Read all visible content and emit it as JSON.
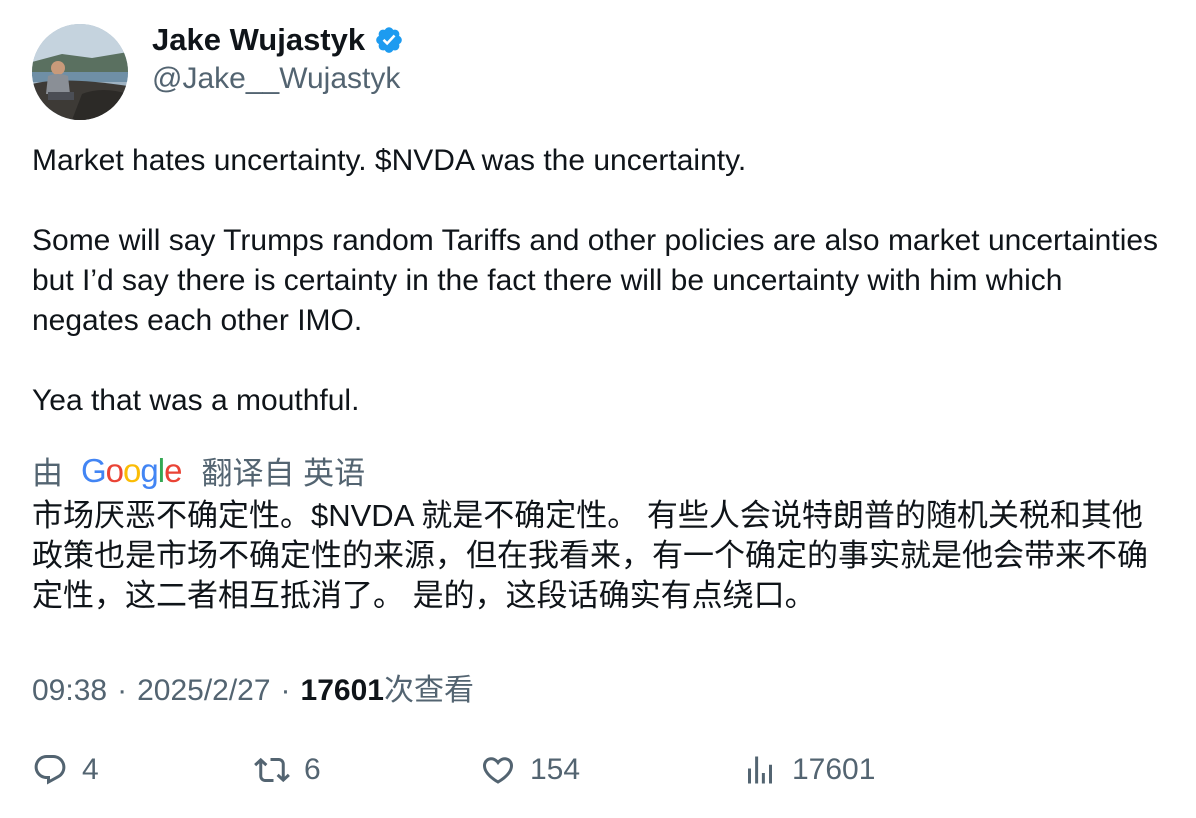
{
  "author": {
    "display_name": "Jake Wujastyk",
    "handle": "@Jake__Wujastyk",
    "verified": true
  },
  "tweet": {
    "paragraphs": [
      "Market hates uncertainty. $NVDA was the uncertainty.",
      "Some will say Trumps random Tariffs and other policies are also market uncertainties but I’d say there is certainty in the fact there will be uncertainty with him which negates each other IMO.",
      "Yea that was a mouthful."
    ]
  },
  "translation": {
    "prefix": "由",
    "provider": "Google",
    "suffix": "翻译自 英语",
    "text": "市场厌恶不确定性。$NVDA 就是不确定性。 有些人会说特朗普的随机关税和其他政策也是市场不确定性的来源，但在我看来，有一个确定的事实就是他会带来不确定性，这二者相互抵消了。 是的，这段话确实有点绕口。"
  },
  "meta": {
    "time": "09:38",
    "date": "2025/2/27",
    "view_count": "17601",
    "view_label": "次查看"
  },
  "actions": {
    "replies": "4",
    "retweets": "6",
    "likes": "154",
    "views": "17601"
  },
  "icons": [
    "verified-badge-icon",
    "reply-icon",
    "retweet-icon",
    "like-icon",
    "analytics-icon"
  ],
  "colors": {
    "text_primary": "#0f1419",
    "text_secondary": "#536471",
    "verified_blue": "#1d9bf0"
  }
}
